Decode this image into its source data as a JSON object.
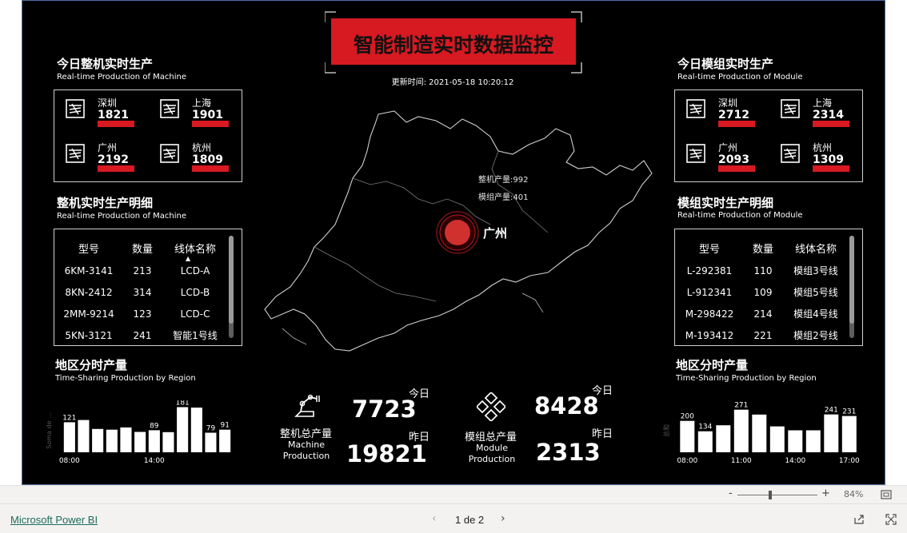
{
  "header": {
    "title": "智能制造实时数据监控",
    "update_time": "更新时间: 2021-05-18 10:20:12"
  },
  "left_summary": {
    "title": "今日整机实时生产",
    "subtitle": "Real-time Production of  Machine",
    "cities": [
      {
        "name": "深圳",
        "value": "1821"
      },
      {
        "name": "上海",
        "value": "1901"
      },
      {
        "name": "广州",
        "value": "2192"
      },
      {
        "name": "杭州",
        "value": "1809"
      }
    ]
  },
  "right_summary": {
    "title": "今日模组实时生产",
    "subtitle": "Real-time Production of  Module",
    "cities": [
      {
        "name": "深圳",
        "value": "2712"
      },
      {
        "name": "上海",
        "value": "2314"
      },
      {
        "name": "广州",
        "value": "2093"
      },
      {
        "name": "杭州",
        "value": "1309"
      }
    ]
  },
  "left_detail": {
    "title": "整机实时生产明细",
    "subtitle": "Real-time Production of  Machine",
    "headers": [
      "型号",
      "数量",
      "线体名称"
    ],
    "rows": [
      [
        "6KM-3141",
        "213",
        "LCD-A"
      ],
      [
        "8KN-2412",
        "314",
        "LCD-B"
      ],
      [
        "2MM-9214",
        "123",
        "LCD-C"
      ],
      [
        "5KN-3121",
        "241",
        "智能1号线"
      ]
    ]
  },
  "right_detail": {
    "title": "模组实时生产明细",
    "subtitle": "Real-time Production of  Module",
    "headers": [
      "型号",
      "数量",
      "线体名称"
    ],
    "rows": [
      [
        "L-292381",
        "110",
        "模组3号线"
      ],
      [
        "L-912341",
        "109",
        "模组5号线"
      ],
      [
        "M-298422",
        "214",
        "模组4号线"
      ],
      [
        "M-193412",
        "221",
        "模组2号线"
      ]
    ]
  },
  "map": {
    "city": "广州",
    "tooltip_machine": "整机产量:992",
    "tooltip_module": "模组产量:401"
  },
  "machine_total": {
    "label": "整机总产量",
    "sub": [
      "Machine",
      "Production"
    ],
    "today_label": "今日",
    "today_value": "7723",
    "yesterday_label": "昨日",
    "yesterday_value": "19821"
  },
  "module_total": {
    "label": "模组总产量",
    "sub": [
      "Module",
      "Production"
    ],
    "today_label": "今日",
    "today_value": "8428",
    "yesterday_label": "昨日",
    "yesterday_value": "2313"
  },
  "left_region": {
    "title": "地区分时产量",
    "subtitle": "Time-Sharing Production by Region"
  },
  "right_region": {
    "title": "地区分时产量",
    "subtitle": "Time-Sharing Production by Region"
  },
  "chart_data": [
    {
      "type": "bar",
      "ylabel": "Soma de ...",
      "x_ticks": [
        "08:00",
        "14:00"
      ],
      "values": [
        121,
        130,
        94,
        91,
        100,
        82,
        89,
        81,
        182,
        180,
        79,
        91
      ],
      "labels": [
        "121",
        "",
        "",
        "",
        "",
        "",
        "89",
        "",
        "181",
        "",
        "79",
        "91"
      ],
      "ylim": [
        0,
        190
      ]
    },
    {
      "type": "bar",
      "ylabel": "总和",
      "x_ticks": [
        "08:00",
        "11:00",
        "14:00",
        "17:00"
      ],
      "values": [
        200,
        134,
        172,
        271,
        240,
        165,
        140,
        140,
        241,
        231
      ],
      "labels": [
        "200",
        "134",
        "",
        "271",
        "",
        "",
        "",
        "",
        "241",
        "231"
      ],
      "ylim": [
        0,
        290
      ]
    }
  ],
  "statusbar": {
    "zoom_minus": "-",
    "zoom_plus": "+",
    "zoom_value": "84%"
  },
  "footer": {
    "brand": "Microsoft Power BI",
    "page": "1 de 2"
  },
  "colors": {
    "accent": "#d71921",
    "background": "#000000"
  }
}
